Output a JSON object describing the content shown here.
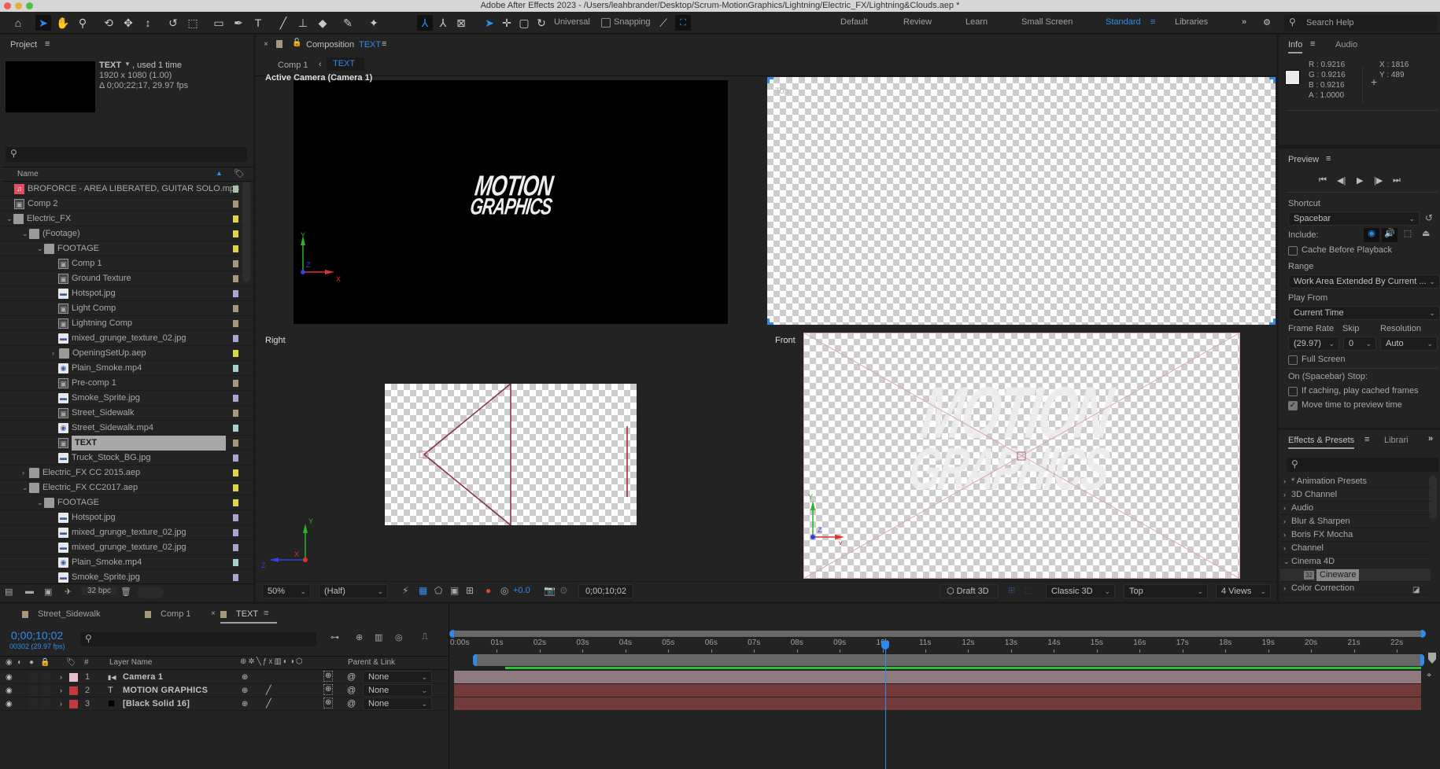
{
  "window": {
    "title": "Adobe After Effects 2023 - /Users/leahbrander/Desktop/Scrum-MotionGraphics/Lightning/Electric_FX/Lightning&Clouds.aep *"
  },
  "toolbar": {
    "tools": [
      "home-icon",
      "selection-icon",
      "hand-icon",
      "zoom-icon",
      "orbit-camera-icon",
      "pan-camera-icon",
      "dolly-camera-icon",
      "rotate-icon",
      "pan-behind-icon",
      "rectangle-icon",
      "pen-icon",
      "type-icon",
      "brush-icon",
      "clone-stamp-icon",
      "eraser-icon",
      "roto-brush-icon",
      "puppet-pin-icon"
    ],
    "axis_mode_label": "Universal",
    "snapping_label": "Snapping",
    "workspaces": [
      "Default",
      "Review",
      "Learn",
      "Small Screen",
      "Standard",
      "Libraries"
    ],
    "active_workspace": "Standard",
    "search_placeholder": "Search Help"
  },
  "project": {
    "title": "Project",
    "preview_name": "TEXT",
    "preview_used": ", used 1 time",
    "preview_size": "1920 x 1080 (1.00)",
    "preview_duration": "Δ 0;00;22;17, 29.97 fps",
    "col_name": "Name",
    "bpc": "32 bpc",
    "items": [
      {
        "name": "BROFORCE - AREA LIBERATED, GUITAR SOLO.mp3",
        "type": "audio",
        "depth": 0,
        "color": "#a9c3a9"
      },
      {
        "name": "Comp 2",
        "type": "comp",
        "depth": 0,
        "color": "#a8987a"
      },
      {
        "name": "Electric_FX",
        "type": "folder",
        "depth": 0,
        "expanded": true,
        "color": "#e0d44a"
      },
      {
        "name": "(Footage)",
        "type": "folder",
        "depth": 1,
        "expanded": true,
        "color": "#e0d44a"
      },
      {
        "name": "FOOTAGE",
        "type": "folder",
        "depth": 2,
        "expanded": true,
        "color": "#e0d44a"
      },
      {
        "name": "Comp 1",
        "type": "comp",
        "depth": 3,
        "color": "#a8987a"
      },
      {
        "name": "Ground Texture",
        "type": "comp",
        "depth": 3,
        "color": "#a8987a"
      },
      {
        "name": "Hotspot.jpg",
        "type": "image",
        "depth": 3,
        "color": "#a6a6d0"
      },
      {
        "name": "Light Comp",
        "type": "comp",
        "depth": 3,
        "color": "#a8987a"
      },
      {
        "name": "Lightning Comp",
        "type": "comp",
        "depth": 3,
        "color": "#a8987a"
      },
      {
        "name": "mixed_grunge_texture_02.jpg",
        "type": "image",
        "depth": 3,
        "color": "#a6a6d0"
      },
      {
        "name": "OpeningSetUp.aep",
        "type": "folder",
        "depth": 3,
        "expanded": false,
        "color": "#e0d44a"
      },
      {
        "name": "Plain_Smoke.mp4",
        "type": "video",
        "depth": 3,
        "color": "#a6d0cc"
      },
      {
        "name": "Pre-comp 1",
        "type": "comp",
        "depth": 3,
        "color": "#a8987a"
      },
      {
        "name": "Smoke_Sprite.jpg",
        "type": "image",
        "depth": 3,
        "color": "#a6a6d0"
      },
      {
        "name": "Street_Sidewalk",
        "type": "comp",
        "depth": 3,
        "color": "#a8987a"
      },
      {
        "name": "Street_Sidewalk.mp4",
        "type": "video",
        "depth": 3,
        "color": "#a6d0cc"
      },
      {
        "name": "TEXT",
        "type": "comp",
        "depth": 3,
        "color": "#a8987a",
        "selected": true
      },
      {
        "name": "Truck_Stock_BG.jpg",
        "type": "image",
        "depth": 3,
        "color": "#a6a6d0"
      },
      {
        "name": "Electric_FX CC 2015.aep",
        "type": "folder",
        "depth": 1,
        "expanded": false,
        "color": "#e0d44a"
      },
      {
        "name": "Electric_FX CC2017.aep",
        "type": "folder",
        "depth": 1,
        "expanded": true,
        "color": "#e0d44a"
      },
      {
        "name": "FOOTAGE",
        "type": "folder",
        "depth": 2,
        "expanded": true,
        "color": "#e0d44a"
      },
      {
        "name": "Hotspot.jpg",
        "type": "image",
        "depth": 3,
        "color": "#a6a6d0"
      },
      {
        "name": "mixed_grunge_texture_02.jpg",
        "type": "image",
        "depth": 3,
        "color": "#a6a6d0"
      },
      {
        "name": "mixed_grunge_texture_02.jpg",
        "type": "image",
        "depth": 3,
        "color": "#a6a6d0"
      },
      {
        "name": "Plain_Smoke.mp4",
        "type": "video",
        "depth": 3,
        "color": "#a6d0cc"
      },
      {
        "name": "Smoke_Sprite.jpg",
        "type": "image",
        "depth": 3,
        "color": "#a6a6d0"
      }
    ]
  },
  "composition": {
    "tab_prefix": "Composition",
    "tab_name": "TEXT",
    "breadcrumb_parent": "Comp 1",
    "breadcrumb_current": "TEXT",
    "views": {
      "active": "Active Camera (Camera 1)",
      "top": "Top",
      "right": "Right",
      "front": "Front"
    },
    "comp_text_line1": "MOTION",
    "comp_text_line2": "GRAPHICS",
    "footer": {
      "zoom": "50%",
      "resolution": "(Half)",
      "exposure": "+0.0",
      "timecode": "0;00;10;02",
      "draft3d": "Draft 3D",
      "renderer": "Classic 3D",
      "view": "Top",
      "layout": "4 Views"
    }
  },
  "info": {
    "tab_info": "Info",
    "tab_audio": "Audio",
    "r": "R :  0.9216",
    "g": "G :  0.9216",
    "b": "B :  0.9216",
    "a": "A :  1.0000",
    "x": "X :  1816",
    "y": "Y :  489",
    "swatch_color": "#ebebeb"
  },
  "preview": {
    "title": "Preview",
    "shortcut_label": "Shortcut",
    "shortcut_value": "Spacebar",
    "include_label": "Include:",
    "cache_label": "Cache Before Playback",
    "cache_checked": false,
    "range_label": "Range",
    "range_value": "Work Area Extended By Current ...",
    "playfrom_label": "Play From",
    "playfrom_value": "Current Time",
    "framerate_label": "Frame Rate",
    "framerate_value": "(29.97)",
    "skip_label": "Skip",
    "skip_value": "0",
    "resolution_label": "Resolution",
    "resolution_value": "Auto",
    "fullscreen_label": "Full Screen",
    "fullscreen_checked": false,
    "stop_label": "On (Spacebar) Stop:",
    "if_caching_label": "If caching, play cached frames",
    "if_caching_checked": false,
    "move_time_label": "Move time to preview time",
    "move_time_checked": true
  },
  "effects": {
    "tab_effects": "Effects & Presets",
    "tab_libraries": "Librari",
    "items": [
      {
        "label": "* Animation Presets",
        "expanded": false
      },
      {
        "label": "3D Channel",
        "expanded": false
      },
      {
        "label": "Audio",
        "expanded": false
      },
      {
        "label": "Blur & Sharpen",
        "expanded": false
      },
      {
        "label": "Boris FX Mocha",
        "expanded": false
      },
      {
        "label": "Channel",
        "expanded": false
      },
      {
        "label": "Cinema 4D",
        "expanded": true
      },
      {
        "label": "Cineware",
        "child": true,
        "selected": true
      },
      {
        "label": "Color Correction",
        "expanded": false
      }
    ]
  },
  "timeline": {
    "tabs": [
      {
        "label": "Street_Sidewalk",
        "color": "#a8987a"
      },
      {
        "label": "Comp 1",
        "color": "#a8987a"
      },
      {
        "label": "TEXT",
        "color": "#a8987a",
        "active": true
      }
    ],
    "timecode": "0;00;10;02",
    "frame_info": "00302 (29.97 fps)",
    "col_layer_name": "Layer Name",
    "col_parent": "Parent & Link",
    "ruler_labels": [
      "0:00s",
      "01s",
      "02s",
      "03s",
      "04s",
      "05s",
      "06s",
      "07s",
      "08s",
      "09s",
      "10s",
      "11s",
      "12s",
      "13s",
      "14s",
      "15s",
      "16s",
      "17s",
      "18s",
      "19s",
      "20s",
      "21s",
      "22s"
    ],
    "duration_seconds": 22.57,
    "current_time_seconds": 10.07,
    "work_area_start_seconds": 0.5,
    "layers": [
      {
        "num": "1",
        "name": "Camera 1",
        "type": "camera",
        "color": "#e8bfcc",
        "parent": "None",
        "bar_color": "#8f7a80"
      },
      {
        "num": "2",
        "name": "MOTION GRAPHICS",
        "type": "text",
        "color": "#c0393c",
        "parent": "None",
        "bar_color": "#733a3c"
      },
      {
        "num": "3",
        "name": "[Black Solid 16]",
        "type": "solid",
        "color": "#c0393c",
        "parent": "None",
        "bar_color": "#733a3c"
      }
    ]
  },
  "colors": {
    "accent": "#2d8ceb",
    "panel_bg": "#232323",
    "camera_wire": "#9a3a52"
  }
}
